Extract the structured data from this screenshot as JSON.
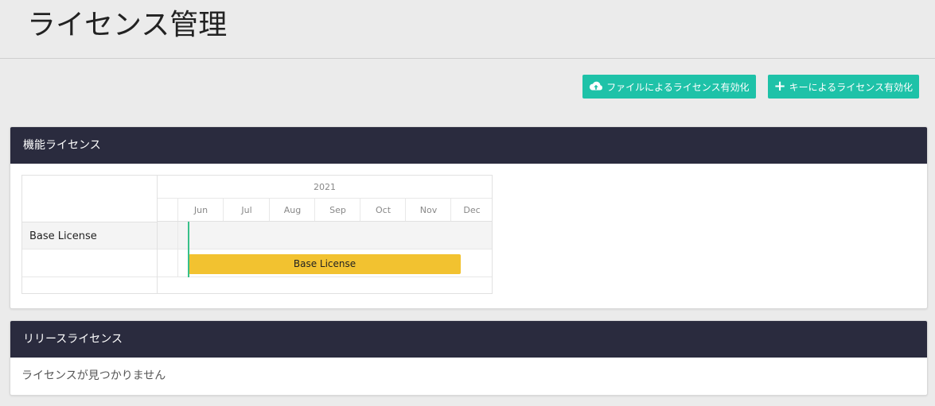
{
  "page": {
    "title": "ライセンス管理"
  },
  "toolbar": {
    "upload_label": "ファイルによるライセンス有効化",
    "key_label": "キーによるライセンス有効化",
    "plus_glyph": "+"
  },
  "feature_panel": {
    "title": "機能ライセンス",
    "gantt": {
      "year": "2021",
      "months": [
        "Jun",
        "Jul",
        "Aug",
        "Sep",
        "Oct",
        "Nov",
        "Dec"
      ],
      "row_label": "Base License",
      "bar_label": "Base License",
      "bar_color": "#f2c230",
      "today_color": "#38c08a"
    }
  },
  "release_panel": {
    "title": "リリースライセンス",
    "empty_text": "ライセンスが見つかりません"
  },
  "colors": {
    "accent": "#1ec2a8",
    "panel_header": "#2a2b3e",
    "background": "#ebebeb"
  }
}
